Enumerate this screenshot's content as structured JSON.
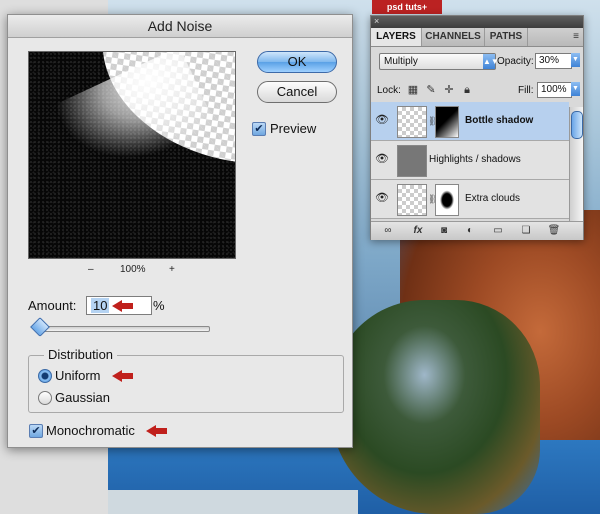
{
  "background": {
    "logo_text": "psd tuts+"
  },
  "dialog": {
    "title": "Add Noise",
    "ok_label": "OK",
    "cancel_label": "Cancel",
    "preview_label": "Preview",
    "preview_checked": true,
    "zoom_minus": "–",
    "zoom_level": "100%",
    "zoom_plus": "+",
    "amount_label": "Amount:",
    "amount_value": "10",
    "amount_unit": "%",
    "slider_value_percent": 10,
    "distribution_title": "Distribution",
    "uniform_label": "Uniform",
    "gaussian_label": "Gaussian",
    "distribution_selected": "Uniform",
    "monochromatic_label": "Monochromatic",
    "monochromatic_checked": true
  },
  "layers_panel": {
    "tabs": [
      "LAYERS",
      "CHANNELS",
      "PATHS"
    ],
    "active_tab": "LAYERS",
    "menu_icon": "≡",
    "blend_mode": "Multiply",
    "opacity_label": "Opacity:",
    "opacity_value": "30%",
    "lock_label": "Lock:",
    "fill_label": "Fill:",
    "fill_value": "100%",
    "layers": [
      {
        "name": "Bottle shadow",
        "selected": true
      },
      {
        "name": "Highlights / shadows",
        "selected": false
      },
      {
        "name": "Extra clouds",
        "selected": false
      }
    ]
  },
  "icons": {
    "eye": "eye-icon",
    "link": "link-icon",
    "mask": "layer-mask-icon",
    "lock": "lock-icon",
    "fx": "fx-icon",
    "adjust": "adjustment-icon",
    "folder": "folder-icon",
    "new": "new-layer-icon",
    "trash": "trash-icon"
  },
  "colors": {
    "accent": "#5aa1e6",
    "arrow": "#c0201c",
    "selection": "#b7d0ee"
  }
}
